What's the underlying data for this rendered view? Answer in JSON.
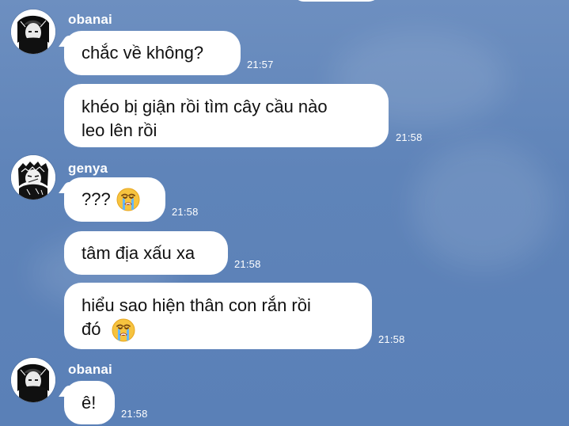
{
  "messages": [
    {
      "sender": "obanai",
      "text": "chắc về không?",
      "time": "21:57"
    },
    {
      "sender": "",
      "text_lines": [
        "khéo bị giận rồi tìm cây cầu nào",
        "leo lên rồi"
      ],
      "time": "21:58"
    },
    {
      "sender": "genya",
      "text": "???",
      "emoji": "crying-face",
      "time": "21:58"
    },
    {
      "sender": "",
      "text": "tâm địa xấu xa",
      "time": "21:58"
    },
    {
      "sender": "",
      "text_lines": [
        "hiểu sao hiện thân con rắn rồi",
        "đó"
      ],
      "emoji": "crying-face",
      "time": "21:58"
    },
    {
      "sender": "obanai",
      "text": "ê!",
      "time": "21:58"
    }
  ],
  "colors": {
    "background": "#5f84b9",
    "bubble": "#ffffff",
    "text": "#111111",
    "meta": "#ffffff"
  },
  "icons": {
    "avatar_obanai": "profile-avatar",
    "avatar_genya": "profile-avatar",
    "emoji": "crying-face"
  }
}
